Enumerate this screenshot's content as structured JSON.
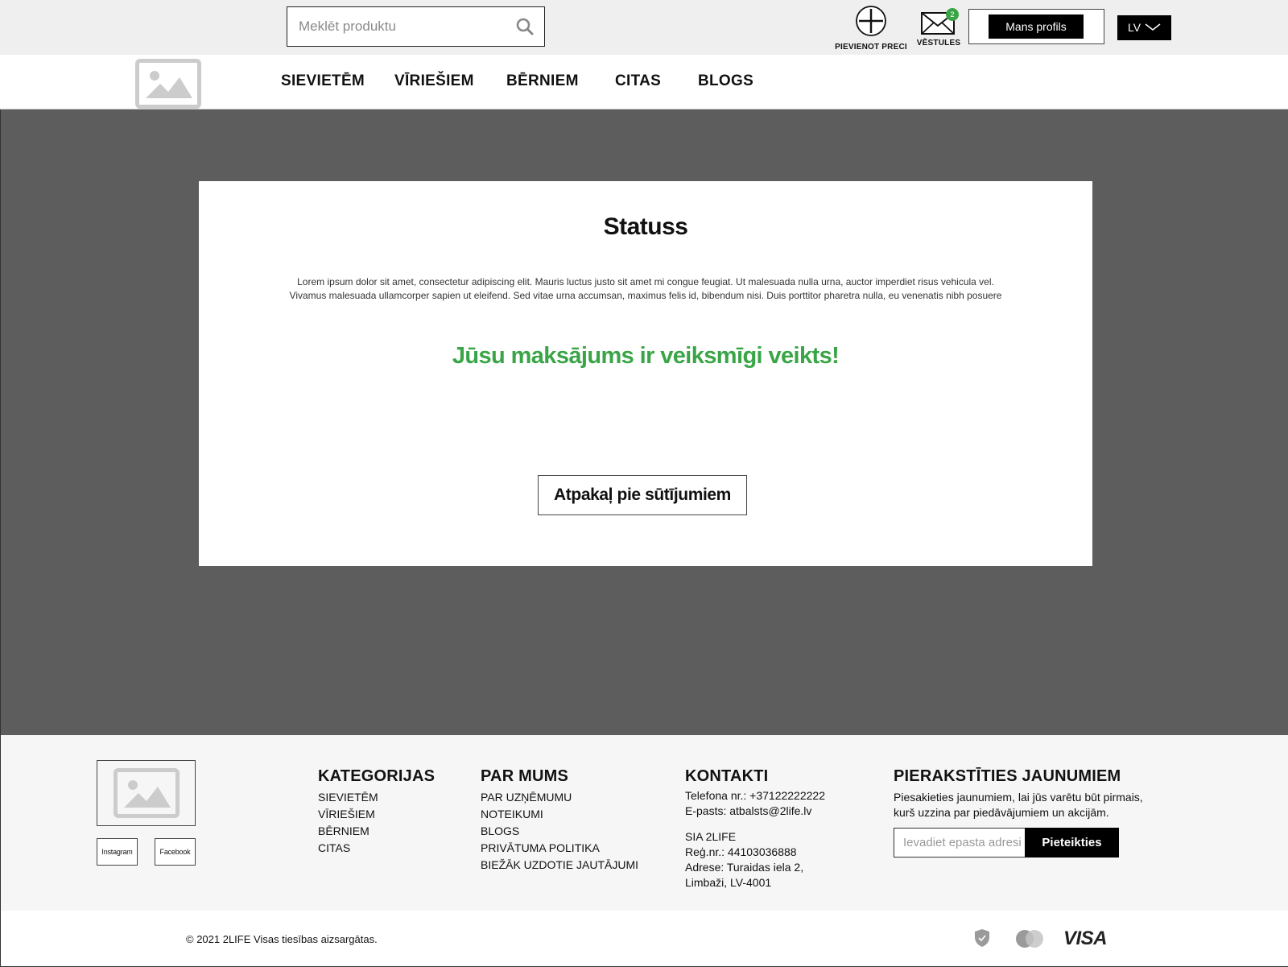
{
  "header": {
    "search": {
      "placeholder": "Meklēt produktu"
    },
    "add_item_label": "PIEVIENOT PRECI",
    "messages_label": "VĒSTULES",
    "messages_count": "2",
    "profile_label": "Mans profils",
    "language": "LV"
  },
  "nav": {
    "items": [
      "SIEVIETĒM",
      "VĪRIEŠIEM",
      "BĒRNIEM",
      "CITAS",
      "BLOGS"
    ]
  },
  "status_card": {
    "title": "Statuss",
    "text": "Lorem ipsum dolor sit amet, consectetur adipiscing elit. Mauris luctus justo sit amet mi congue feugiat. Ut malesuada nulla urna, auctor imperdiet risus vehicula vel. Vivamus malesuada ullamcorper sapien ut eleifend. Sed vitae urna accumsan, maximus felis id, bibendum nisi. Duis porttitor pharetra nulla, eu venenatis nibh posuere",
    "success_message": "Jūsu maksājums ir veiksmīgi veikts!",
    "back_button": "Atpakaļ pie sūtījumiem"
  },
  "footer": {
    "social": {
      "instagram": "Instagram",
      "facebook": "Facebook"
    },
    "categories": {
      "title": "KATEGORIJAS",
      "items": [
        "SIEVIETĒM",
        "VĪRIEŠIEM",
        "BĒRNIEM",
        "CITAS"
      ]
    },
    "about": {
      "title": "PAR MUMS",
      "items": [
        "PAR UZŅĒMUMU",
        "NOTEIKUMI",
        "BLOGS",
        "PRIVĀTUMA POLITIKA",
        "BIEŽĀK UZDOTIE JAUTĀJUMI"
      ]
    },
    "contacts": {
      "title": "KONTAKTI",
      "phone": "Telefona nr.: +37122222222",
      "email": "E-pasts:  atbalsts@2life.lv",
      "company": "SIA 2LIFE",
      "reg": "Reģ.nr.: 44103036888",
      "address_1": "Adrese: Turaidas iela 2,",
      "address_2": "Limbaži, LV-4001"
    },
    "newsletter": {
      "title": "PIERAKSTĪTIES JAUNUMIEM",
      "text": "Piesakieties jaunumiem, lai jūs varētu būt pirmais, kurš uzzina par piedāvājumiem un akcijām.",
      "placeholder": "Ievadiet epasta adresi",
      "button": "Pieteikties"
    },
    "copyright": "© 2021 2LIFE Visas tiesības aizsargātas.",
    "payment_visa": "VISA"
  },
  "colors": {
    "success": "#3aa547",
    "main_background": "#5d5d5d",
    "topbar": "#efefef",
    "footer": "#f6f6f6"
  }
}
